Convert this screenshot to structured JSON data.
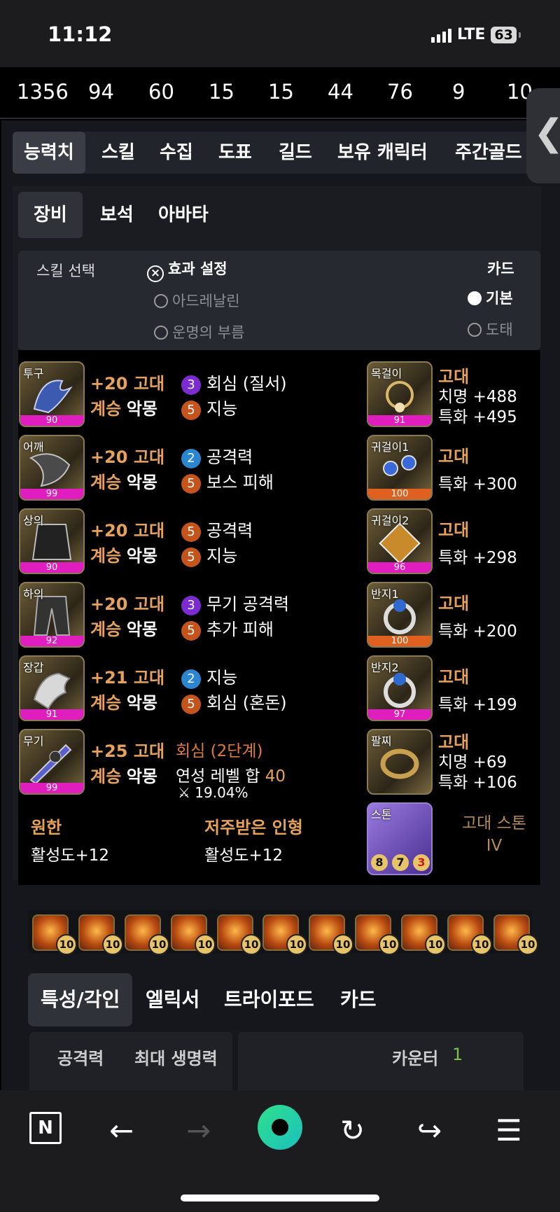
{
  "status": {
    "time": "11:12",
    "network": "LTE",
    "battery": "63"
  },
  "stats": [
    "1356",
    "94",
    "60",
    "15",
    "15",
    "44",
    "76",
    "9",
    "10"
  ],
  "tabs_main": [
    "능력치",
    "스킬",
    "수집",
    "도표",
    "길드",
    "보유 캐릭터",
    "주간골드"
  ],
  "tabs_sub": [
    "장비",
    "보석",
    "아바타"
  ],
  "options": {
    "skill_select": "스킬 선택",
    "effect_setting": "효과 설정",
    "adrenaline": "아드레날린",
    "destiny": "운명의 부름",
    "card": "카드",
    "basic": "기본",
    "thief": "도태"
  },
  "armor": [
    {
      "slot": "투구",
      "quality": "90",
      "upgrade": "+20 고대",
      "set": "계승 악몽",
      "e1n": "3",
      "e1": "회심 (질서)",
      "e2n": "5",
      "e2": "지능"
    },
    {
      "slot": "어깨",
      "quality": "99",
      "upgrade": "+20 고대",
      "set": "계승 악몽",
      "e1n": "2",
      "e1": "공격력",
      "e2n": "5",
      "e2": "보스 피해"
    },
    {
      "slot": "상의",
      "quality": "90",
      "upgrade": "+20 고대",
      "set": "계승 악몽",
      "e1n": "5",
      "e1": "공격력",
      "e2n": "5",
      "e2": "지능"
    },
    {
      "slot": "하의",
      "quality": "92",
      "upgrade": "+20 고대",
      "set": "계승 악몽",
      "e1n": "3",
      "e1": "무기 공격력",
      "e2n": "5",
      "e2": "추가 피해"
    },
    {
      "slot": "장갑",
      "quality": "91",
      "upgrade": "+21 고대",
      "set": "계승 악몽",
      "e1n": "2",
      "e1": "지능",
      "e2n": "5",
      "e2": "회심 (혼돈)"
    },
    {
      "slot": "무기",
      "quality": "99",
      "upgrade": "+25 고대",
      "set": "계승 악몽",
      "e1": "회심 (2단계)",
      "e2": "연성 레벨 합",
      "e2v": "40",
      "pct": "19.04%"
    }
  ],
  "accessories": [
    {
      "slot": "목걸이",
      "quality": "91",
      "grade": "고대",
      "l1": "치명 +488",
      "l2": "특화 +495"
    },
    {
      "slot": "귀걸이1",
      "quality": "100",
      "grade": "고대",
      "l1": "특화 +300"
    },
    {
      "slot": "귀걸이2",
      "quality": "96",
      "grade": "고대",
      "l1": "특화 +298"
    },
    {
      "slot": "반지1",
      "quality": "100",
      "grade": "고대",
      "l1": "특화 +200"
    },
    {
      "slot": "반지2",
      "quality": "97",
      "grade": "고대",
      "l1": "특화 +199"
    },
    {
      "slot": "팔찌",
      "grade": "고대",
      "l1": "치명 +69",
      "l2": "특화 +106"
    }
  ],
  "stone": {
    "slot": "스톤",
    "name": "고대 스톤",
    "tier": "IV",
    "n1": "8",
    "n2": "7",
    "n3": "3"
  },
  "bottom_effects": [
    {
      "title": "원한",
      "value": "활성도+12"
    },
    {
      "title": "저주받은 인형",
      "value": "활성도+12"
    }
  ],
  "gem_level": "10",
  "tabs_bottom": [
    "특성/각인",
    "엘릭서",
    "트라이포드",
    "카드"
  ],
  "stats_bottom": {
    "attack_label": "공격력",
    "hp_label": "최대 생명력",
    "counter_label": "카운터",
    "counter_value": "1"
  }
}
